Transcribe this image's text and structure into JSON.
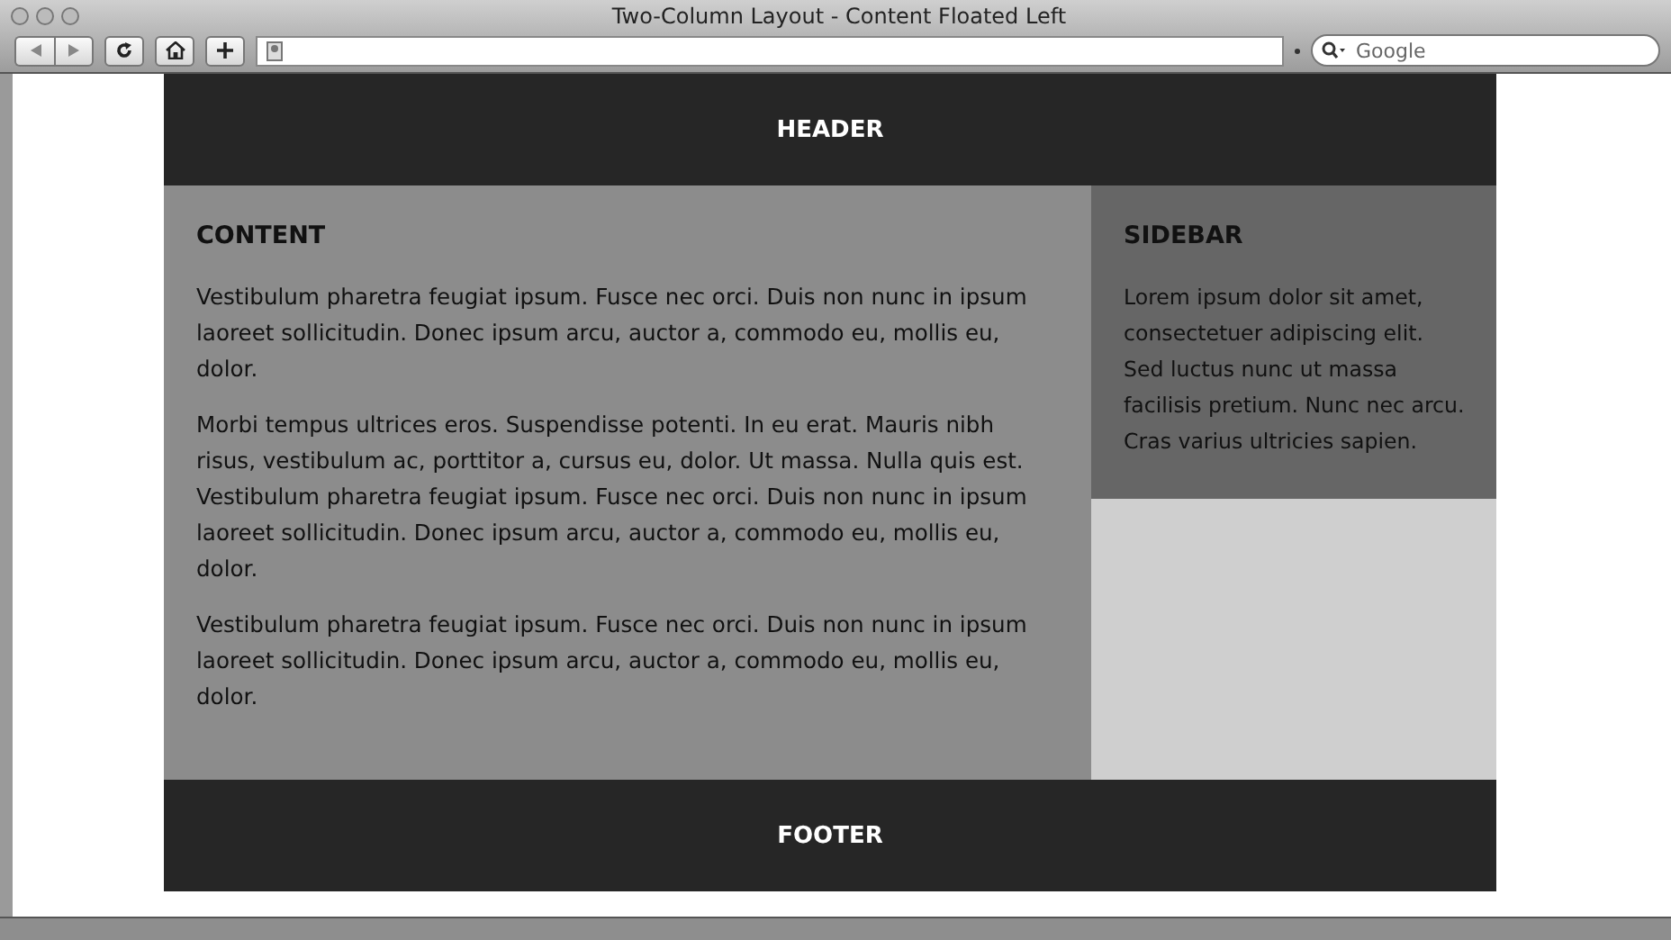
{
  "window": {
    "title": "Two-Column Layout - Content Floated Left"
  },
  "toolbar": {
    "search": {
      "placeholder": "Google"
    }
  },
  "page": {
    "header": "HEADER",
    "content": {
      "heading": "CONTENT",
      "paragraphs": [
        "Vestibulum pharetra feugiat ipsum. Fusce nec orci. Duis non nunc in ipsum laoreet sollicitudin. Donec ipsum arcu, auctor a, commodo eu, mollis eu, dolor.",
        "Morbi tempus ultrices eros. Suspendisse potenti. In eu erat. Mauris nibh risus, vestibulum ac, porttitor a, cursus eu, dolor. Ut massa. Nulla quis est. Vestibulum pharetra feugiat ipsum. Fusce nec orci. Duis non nunc in ipsum laoreet sollicitudin. Donec ipsum arcu, auctor a, commodo eu, mollis eu, dolor.",
        "Vestibulum pharetra feugiat ipsum. Fusce nec orci. Duis non nunc in ipsum laoreet sollicitudin. Donec ipsum arcu, auctor a, commodo eu, mollis eu, dolor."
      ]
    },
    "sidebar": {
      "heading": "SIDEBAR",
      "paragraphs": [
        "Lorem ipsum dolor sit amet, consectetuer adipiscing elit. Sed luctus nunc ut massa facilisis pretium. Nunc nec arcu. Cras varius ultricies sapien."
      ]
    },
    "footer": "FOOTER"
  }
}
